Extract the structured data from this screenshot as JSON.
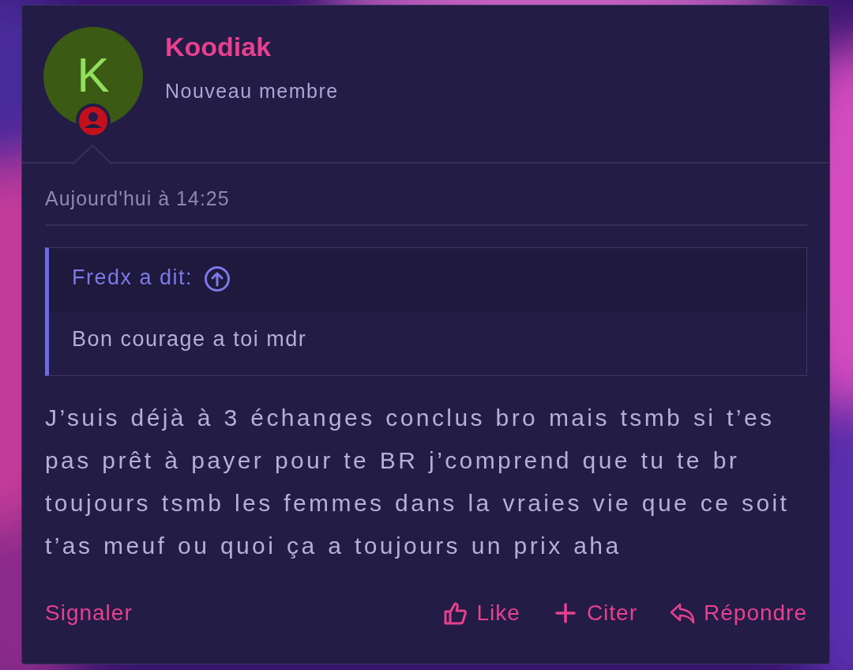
{
  "post": {
    "author": {
      "initial": "K",
      "name": "Koodiak",
      "role": "Nouveau membre"
    },
    "date": "Aujourd'hui à 14:25",
    "quote": {
      "attribution": "Fredx a dit:",
      "text": "Bon courage a toi mdr"
    },
    "message": "J’suis déjà à 3 échanges conclus bro mais tsmb si t’es pas prêt à payer pour te BR j’comprend que tu te br toujours tsmb les femmes dans la vraies vie que ce soit t’as meuf ou quoi ça a toujours un prix aha",
    "actions": [
      {
        "kind": "report",
        "label": "Signaler"
      },
      {
        "kind": "like",
        "label": "Like"
      },
      {
        "kind": "quote",
        "label": "Citer"
      },
      {
        "kind": "reply",
        "label": "Répondre"
      }
    ]
  }
}
